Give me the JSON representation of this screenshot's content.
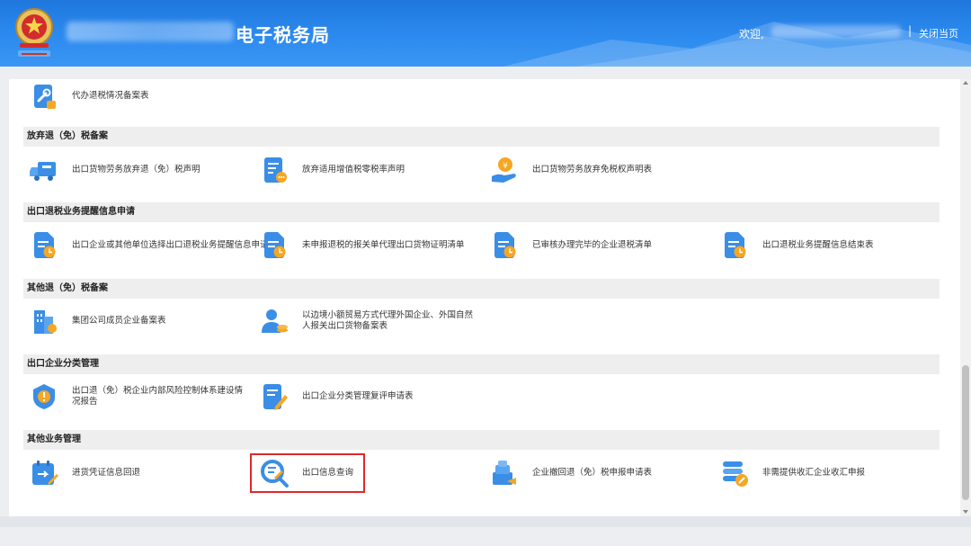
{
  "header": {
    "title": "电子税务局",
    "welcome": "欢迎,",
    "separator": "|",
    "close_page": "关闭当页"
  },
  "sections": [
    {
      "name": "top",
      "items": [
        {
          "label": "代办退税情况备案表",
          "icon": "wrench-doc-icon"
        }
      ]
    },
    {
      "name": "abandon",
      "title": "放弃退（免）税备案",
      "items": [
        {
          "label": "出口货物劳务放弃退（免）税声明",
          "icon": "truck-icon"
        },
        {
          "label": "放弃适用增值税零税率声明",
          "icon": "document-dots-icon"
        },
        {
          "label": "出口货物劳务放弃免税权声明表",
          "icon": "hand-coin-icon"
        }
      ]
    },
    {
      "name": "reminder",
      "title": "出口退税业务提醒信息申请",
      "items": [
        {
          "label": "出口企业或其他单位选择出口退税业务提醒信息申请表",
          "icon": "clock-doc-icon"
        },
        {
          "label": "未申报退税的报关单代理出口货物证明清单",
          "icon": "clock-doc-icon"
        },
        {
          "label": "已审核办理完毕的企业退税清单",
          "icon": "clock-doc-icon"
        },
        {
          "label": "出口退税业务提醒信息结束表",
          "icon": "clock-doc-icon"
        }
      ]
    },
    {
      "name": "other-filing",
      "title": "其他退（免）税备案",
      "items": [
        {
          "label": "集团公司成员企业备案表",
          "icon": "building-icon"
        },
        {
          "label": "以边境小额贸易方式代理外国企业、外国自然人报关出口货物备案表",
          "icon": "person-coins-icon"
        }
      ]
    },
    {
      "name": "classification",
      "title": "出口企业分类管理",
      "items": [
        {
          "label": "出口退（免）税企业内部风险控制体系建设情况报告",
          "icon": "shield-icon"
        },
        {
          "label": "出口企业分类管理复评申请表",
          "icon": "doc-pen-icon"
        }
      ]
    },
    {
      "name": "other-business",
      "title": "其他业务管理",
      "items": [
        {
          "label": "进货凭证信息回退",
          "icon": "calendar-return-icon"
        },
        {
          "label": "出口信息查询",
          "icon": "search-doc-icon"
        },
        {
          "label": "企业撤回退（免）税申报申请表",
          "icon": "stack-doc-icon"
        },
        {
          "label": "非需提供收汇企业收汇申报",
          "icon": "coins-stack-icon"
        }
      ]
    }
  ],
  "colors": {
    "header_blue": "#2e8cf0",
    "icon_blue": "#3a8ee6",
    "icon_orange": "#f5a623",
    "highlight_red": "#e0282b",
    "section_bg": "#eeeeee"
  }
}
